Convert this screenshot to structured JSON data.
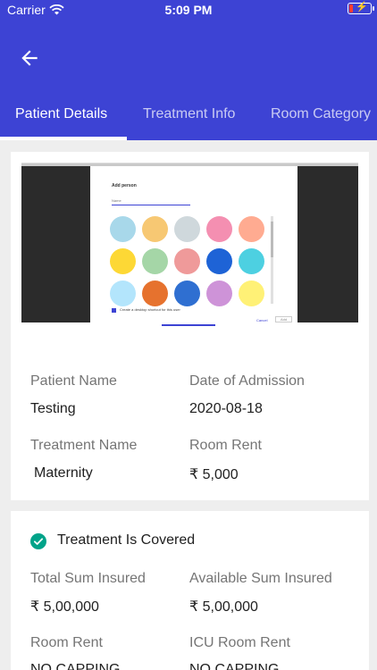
{
  "status_bar": {
    "carrier": "Carrier",
    "time": "5:09 PM"
  },
  "tabs": [
    {
      "label": "Patient Details",
      "active": true
    },
    {
      "label": "Treatment Info",
      "active": false
    },
    {
      "label": "Room Category",
      "active": false
    }
  ],
  "screenshot_preview": {
    "dialog_title": "Add person",
    "input_placeholder": "Name",
    "checkbox_label": "Create a desktop shortcut for this user",
    "cancel_label": "Cancel",
    "add_label": "Add"
  },
  "patient": {
    "name_label": "Patient Name",
    "name_value": "Testing",
    "admission_label": "Date of Admission",
    "admission_value": "2020-08-18",
    "treatment_label": "Treatment Name",
    "treatment_value": "Maternity",
    "room_rent_label": "Room Rent",
    "room_rent_value": "₹ 5,000"
  },
  "coverage": {
    "status": "Treatment Is Covered",
    "total_label": "Total Sum Insured",
    "total_value": "₹ 5,00,000",
    "available_label": "Available Sum Insured",
    "available_value": "₹ 5,00,000",
    "room_rent_label": "Room Rent",
    "room_rent_value": "NO CAPPING",
    "icu_label": "ICU Room Rent",
    "icu_value": "NO CAPPING"
  },
  "colors": {
    "primary": "#3d43d4",
    "success": "#00a389"
  },
  "icons": {
    "back": "arrow-left-icon",
    "wifi": "wifi-icon",
    "battery": "battery-charging-icon",
    "covered": "check-circle-icon"
  }
}
